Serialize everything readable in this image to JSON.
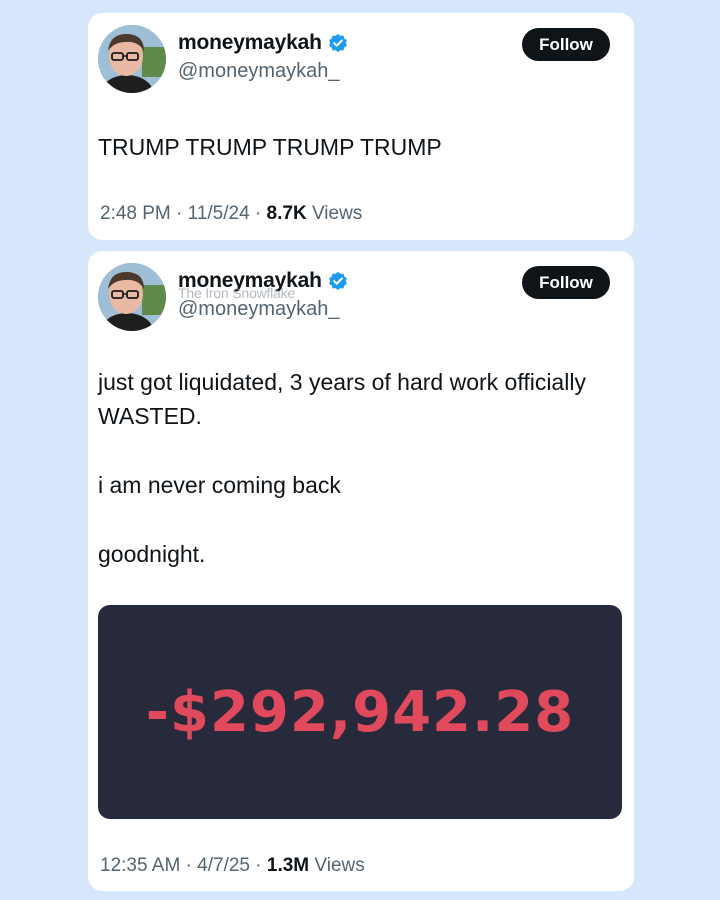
{
  "colors": {
    "page_background": "#d6e6fb",
    "card_background": "#ffffff",
    "follow_button": "#0f1419",
    "verified_badge": "#1d9bf0",
    "loss_red": "#e04a5c",
    "media_background": "#262a3b",
    "secondary_text": "#536471"
  },
  "tweets": [
    {
      "author": {
        "display_name": "moneymaykah",
        "handle": "@moneymaykah_",
        "verified_icon": "verified-badge-icon"
      },
      "follow_label": "Follow",
      "text_lines": [
        "TRUMP TRUMP TRUMP TRUMP"
      ],
      "meta": {
        "time": "2:48 PM",
        "date": "11/5/24",
        "views_count": "8.7K",
        "views_label": "Views"
      }
    },
    {
      "author": {
        "display_name": "moneymaykah",
        "handle": "@moneymaykah_",
        "verified_icon": "verified-badge-icon"
      },
      "watermark": "The Iron Snowflake",
      "follow_label": "Follow",
      "text_lines": [
        "just got liquidated, 3 years of hard work officially WASTED.",
        "i am never coming back",
        "goodnight."
      ],
      "media_text": "-$292,942.28",
      "meta": {
        "time": "12:35 AM",
        "date": "4/7/25",
        "views_count": "1.3M",
        "views_label": "Views"
      }
    }
  ]
}
